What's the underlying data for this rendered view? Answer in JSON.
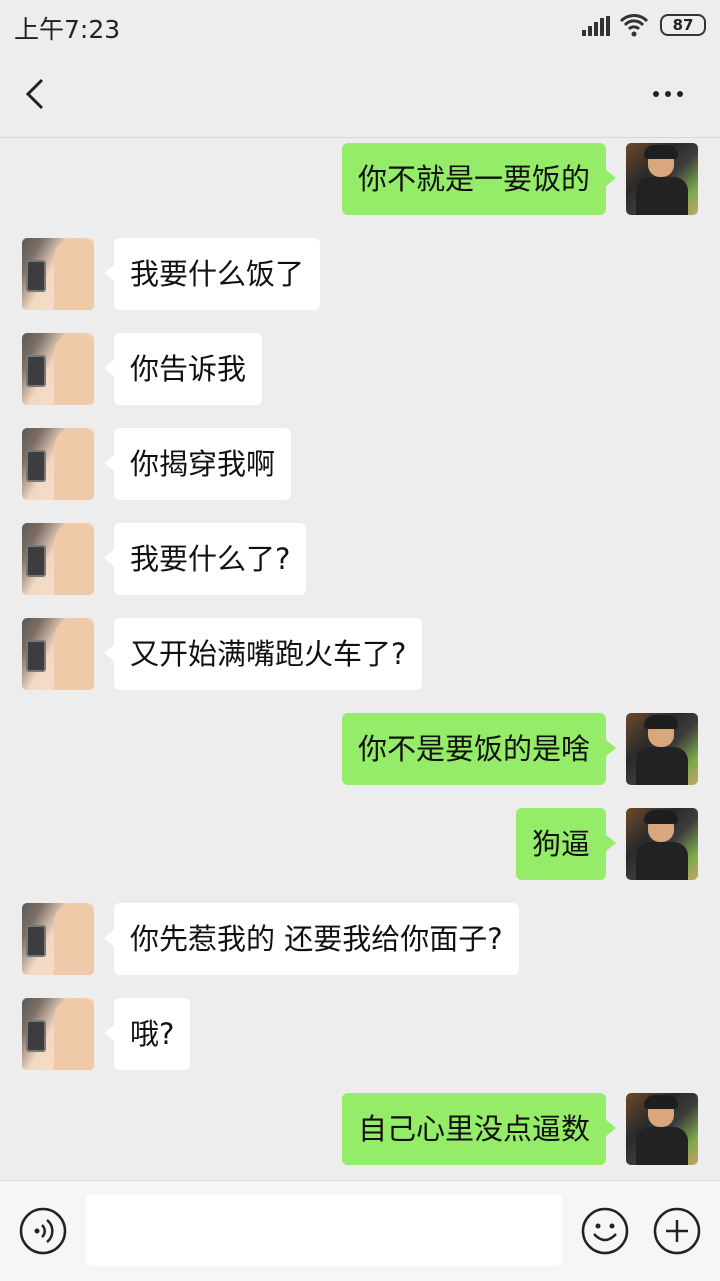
{
  "status_bar": {
    "time": "上午7:23",
    "battery": "87",
    "icons": [
      "signal-icon",
      "wifi-icon",
      "battery-icon"
    ]
  },
  "header": {
    "back_icon": "chevron-left-icon",
    "more_icon": "more-dots-icon"
  },
  "messages": [
    {
      "sender": "self",
      "text": "你不就是一要饭的"
    },
    {
      "sender": "other",
      "text": "我要什么饭了"
    },
    {
      "sender": "other",
      "text": "你告诉我"
    },
    {
      "sender": "other",
      "text": "你揭穿我啊"
    },
    {
      "sender": "other",
      "text": "我要什么了?"
    },
    {
      "sender": "other",
      "text": "又开始满嘴跑火车了?"
    },
    {
      "sender": "self",
      "text": "你不是要饭的是啥"
    },
    {
      "sender": "self",
      "text": "狗逼"
    },
    {
      "sender": "other",
      "text": "你先惹我的 还要我给你面子?"
    },
    {
      "sender": "other",
      "text": "哦?"
    },
    {
      "sender": "self",
      "text": "自己心里没点逼数"
    }
  ],
  "input_bar": {
    "text_value": "",
    "icons": [
      "voice-icon",
      "emoji-icon",
      "plus-icon"
    ]
  },
  "colors": {
    "self_bubble": "#95ec69",
    "other_bubble": "#ffffff",
    "background": "#ededed"
  }
}
